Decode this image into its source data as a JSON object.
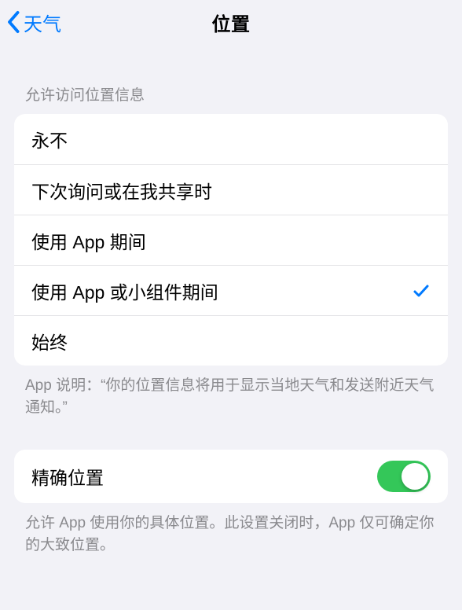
{
  "nav": {
    "back_label": "天气",
    "title": "位置"
  },
  "section1": {
    "header": "允许访问位置信息",
    "options": {
      "o0": "永不",
      "o1": "下次询问或在我共享时",
      "o2": "使用 App 期间",
      "o3": "使用 App 或小组件期间",
      "o4": "始终"
    },
    "selected_index": 3,
    "footer": "App 说明：“你的位置信息将用于显示当地天气和发送附近天气通知。”"
  },
  "section2": {
    "precise_label": "精确位置",
    "precise_on": true,
    "footer": "允许 App 使用你的具体位置。此设置关闭时，App 仅可确定你的大致位置。"
  }
}
